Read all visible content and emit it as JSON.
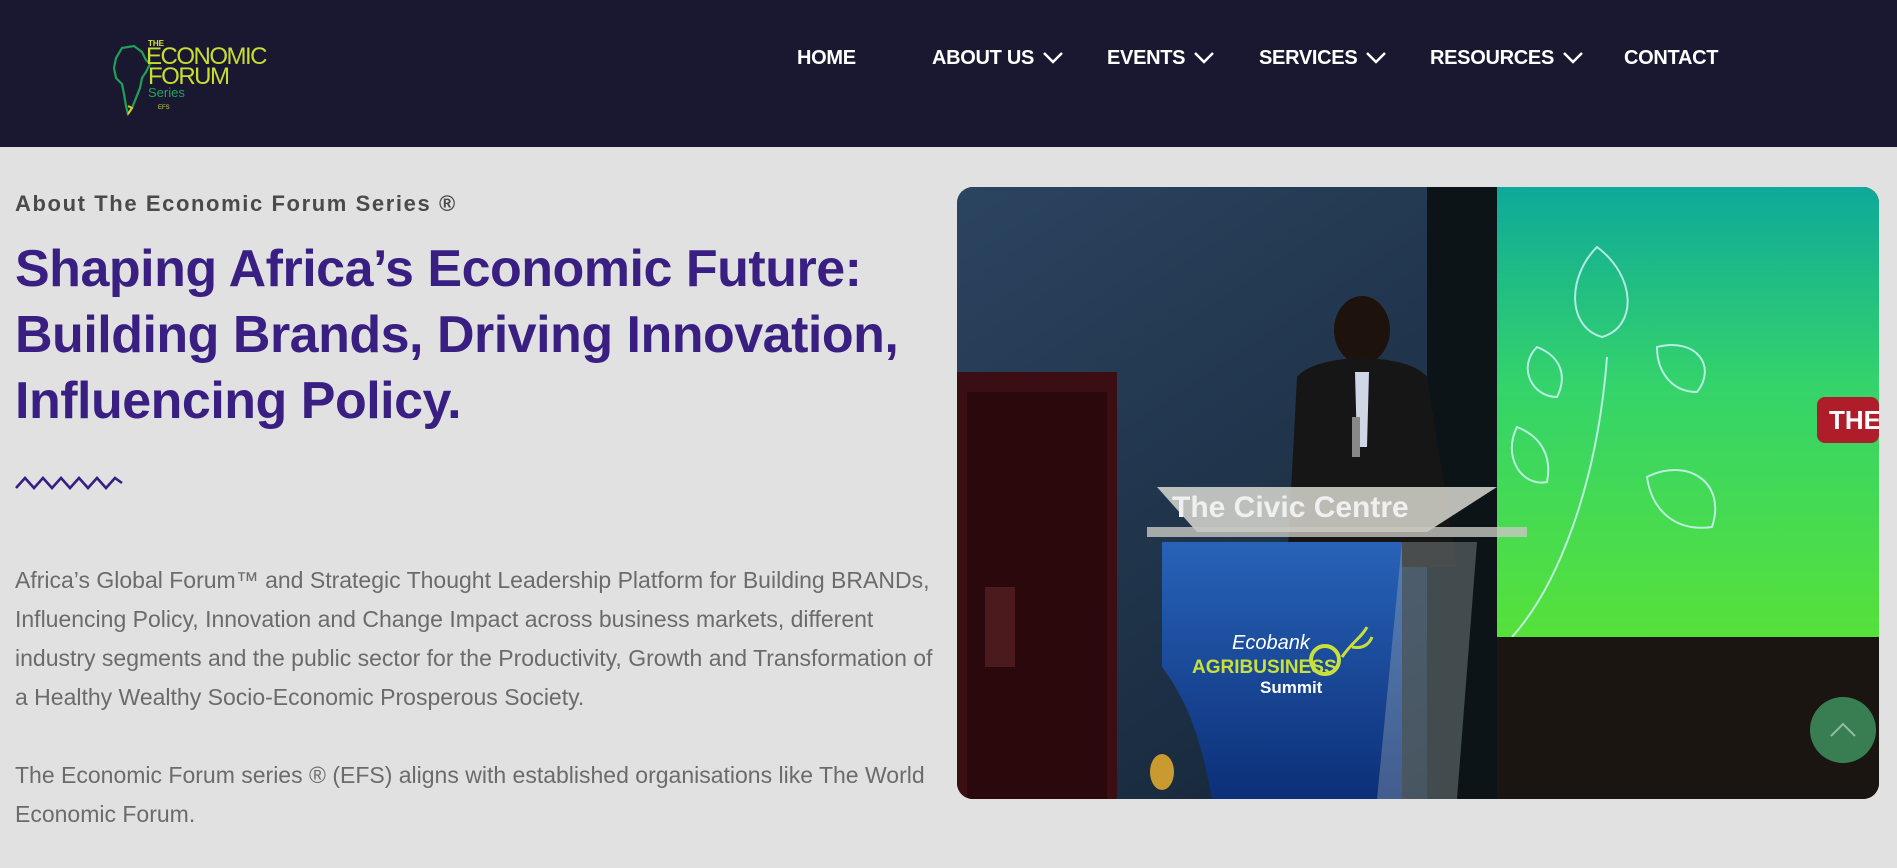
{
  "brand": {
    "logo_the": "THE",
    "logo_line1": "ECONOMIC",
    "logo_line2": "FORUM",
    "logo_line3": "Series",
    "logo_line4": "EFS"
  },
  "nav": {
    "items": [
      {
        "label": "HOME",
        "has_dropdown": false
      },
      {
        "label": "ABOUT US",
        "has_dropdown": true
      },
      {
        "label": "EVENTS",
        "has_dropdown": true
      },
      {
        "label": "SERVICES",
        "has_dropdown": true
      },
      {
        "label": "RESOURCES",
        "has_dropdown": true
      },
      {
        "label": "CONTACT",
        "has_dropdown": false
      }
    ]
  },
  "about": {
    "kicker": "About The Economic Forum Series ®",
    "headline_line1": "Shaping Africa’s Economic Future:",
    "headline_line2": "Building Brands, Driving Innovation,",
    "headline_line3": "Influencing Policy.",
    "paragraph1": "Africa’s Global Forum™ and Strategic Thought Leadership Platform for Building BRANDs, Influencing Policy, Innovation and Change Impact across business markets, different industry segments and the public sector for the Productivity, Growth and Transformation of a Healthy Wealthy Socio-Economic Prosperous Society.",
    "paragraph2": "The Economic Forum series ® (EFS) aligns with established organisations like The World Economic Forum."
  },
  "photo": {
    "podium_text": "The Civic Centre",
    "sign_line1": "Ecobank",
    "sign_line2": "AGRIBUSINESS",
    "sign_line3": "Summit",
    "screen_badge": "THE"
  },
  "colors": {
    "header_bg": "#1a1831",
    "headline": "#3a1f82",
    "page_bg": "#e1e1e1",
    "scroll_button": "#3d8a5a"
  }
}
